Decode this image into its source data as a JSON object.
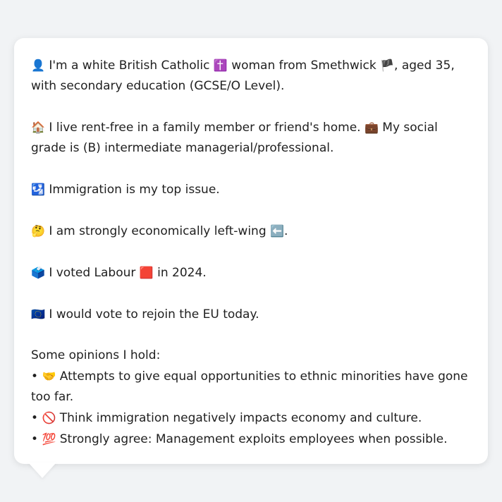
{
  "profile": {
    "identity": {
      "icon": "👤",
      "text_a": "I'm a white British Catholic",
      "icon2": "✝️",
      "text_b": "woman from Smethwick",
      "icon3": "🏴",
      "text_c": ", aged 35, with secondary education (GCSE/O Level)."
    },
    "housing": {
      "icon": "🏠",
      "text_a": "I live rent-free in a family member or friend's home.",
      "icon2": "💼",
      "text_b": "My social grade is (B) intermediate managerial/professional."
    },
    "issue": {
      "icon": "🛂",
      "text": "Immigration is my top issue."
    },
    "economics": {
      "icon": "🤔",
      "text": "I am strongly economically left-wing",
      "icon2": "⬅️",
      "suffix": "."
    },
    "vote": {
      "icon": "🗳️",
      "text_a": "I voted Labour",
      "icon2": "🟥",
      "text_b": "in 2024."
    },
    "eu": {
      "icon": "🇪🇺",
      "text": "I would vote to rejoin the EU today."
    },
    "opinions_heading": "Some opinions I hold:",
    "opinions": [
      {
        "bullet": "•",
        "icon": "🤝",
        "text": "Attempts to give equal opportunities to ethnic minorities have gone too far."
      },
      {
        "bullet": "•",
        "icon": "🚫",
        "text": "Think immigration negatively impacts economy and culture."
      },
      {
        "bullet": "•",
        "icon": "💯",
        "text": "Strongly agree: Management exploits employees when possible."
      }
    ]
  }
}
